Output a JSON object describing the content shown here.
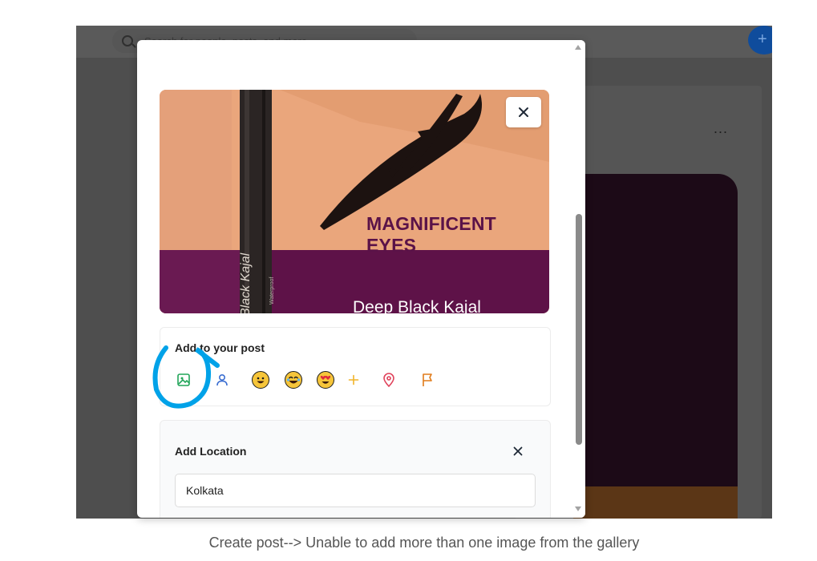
{
  "background": {
    "search_placeholder": "Search for people, posts, and more...",
    "more_label": "...",
    "plus_label": "+"
  },
  "modal": {
    "photo": {
      "product_title": "MAGNIFICENT\nEYES",
      "product_subtitle": "Deep Black Kajal",
      "pencil_text": "Black Kajal",
      "pencil_small_text": "Waterproof",
      "close_icon": "close-icon"
    },
    "add_to_post": {
      "title": "Add to your post",
      "icons": [
        "image-icon",
        "user-tag-icon",
        "smile-emoji-icon",
        "laugh-emoji-icon",
        "heart-eyes-emoji-icon",
        "plus-icon",
        "location-pin-icon",
        "flag-icon"
      ],
      "colors": {
        "image": "#22a559",
        "user": "#3b6ed1",
        "plus": "#f0b429",
        "location": "#e0425b",
        "flag": "#e07b1a"
      }
    },
    "location": {
      "title": "Add Location",
      "value": "Kolkata",
      "close_icon": "close-icon"
    }
  },
  "annotation": {
    "highlight_color": "#00a2e8"
  },
  "caption": "Create post--> Unable to add more than one image from the gallery"
}
